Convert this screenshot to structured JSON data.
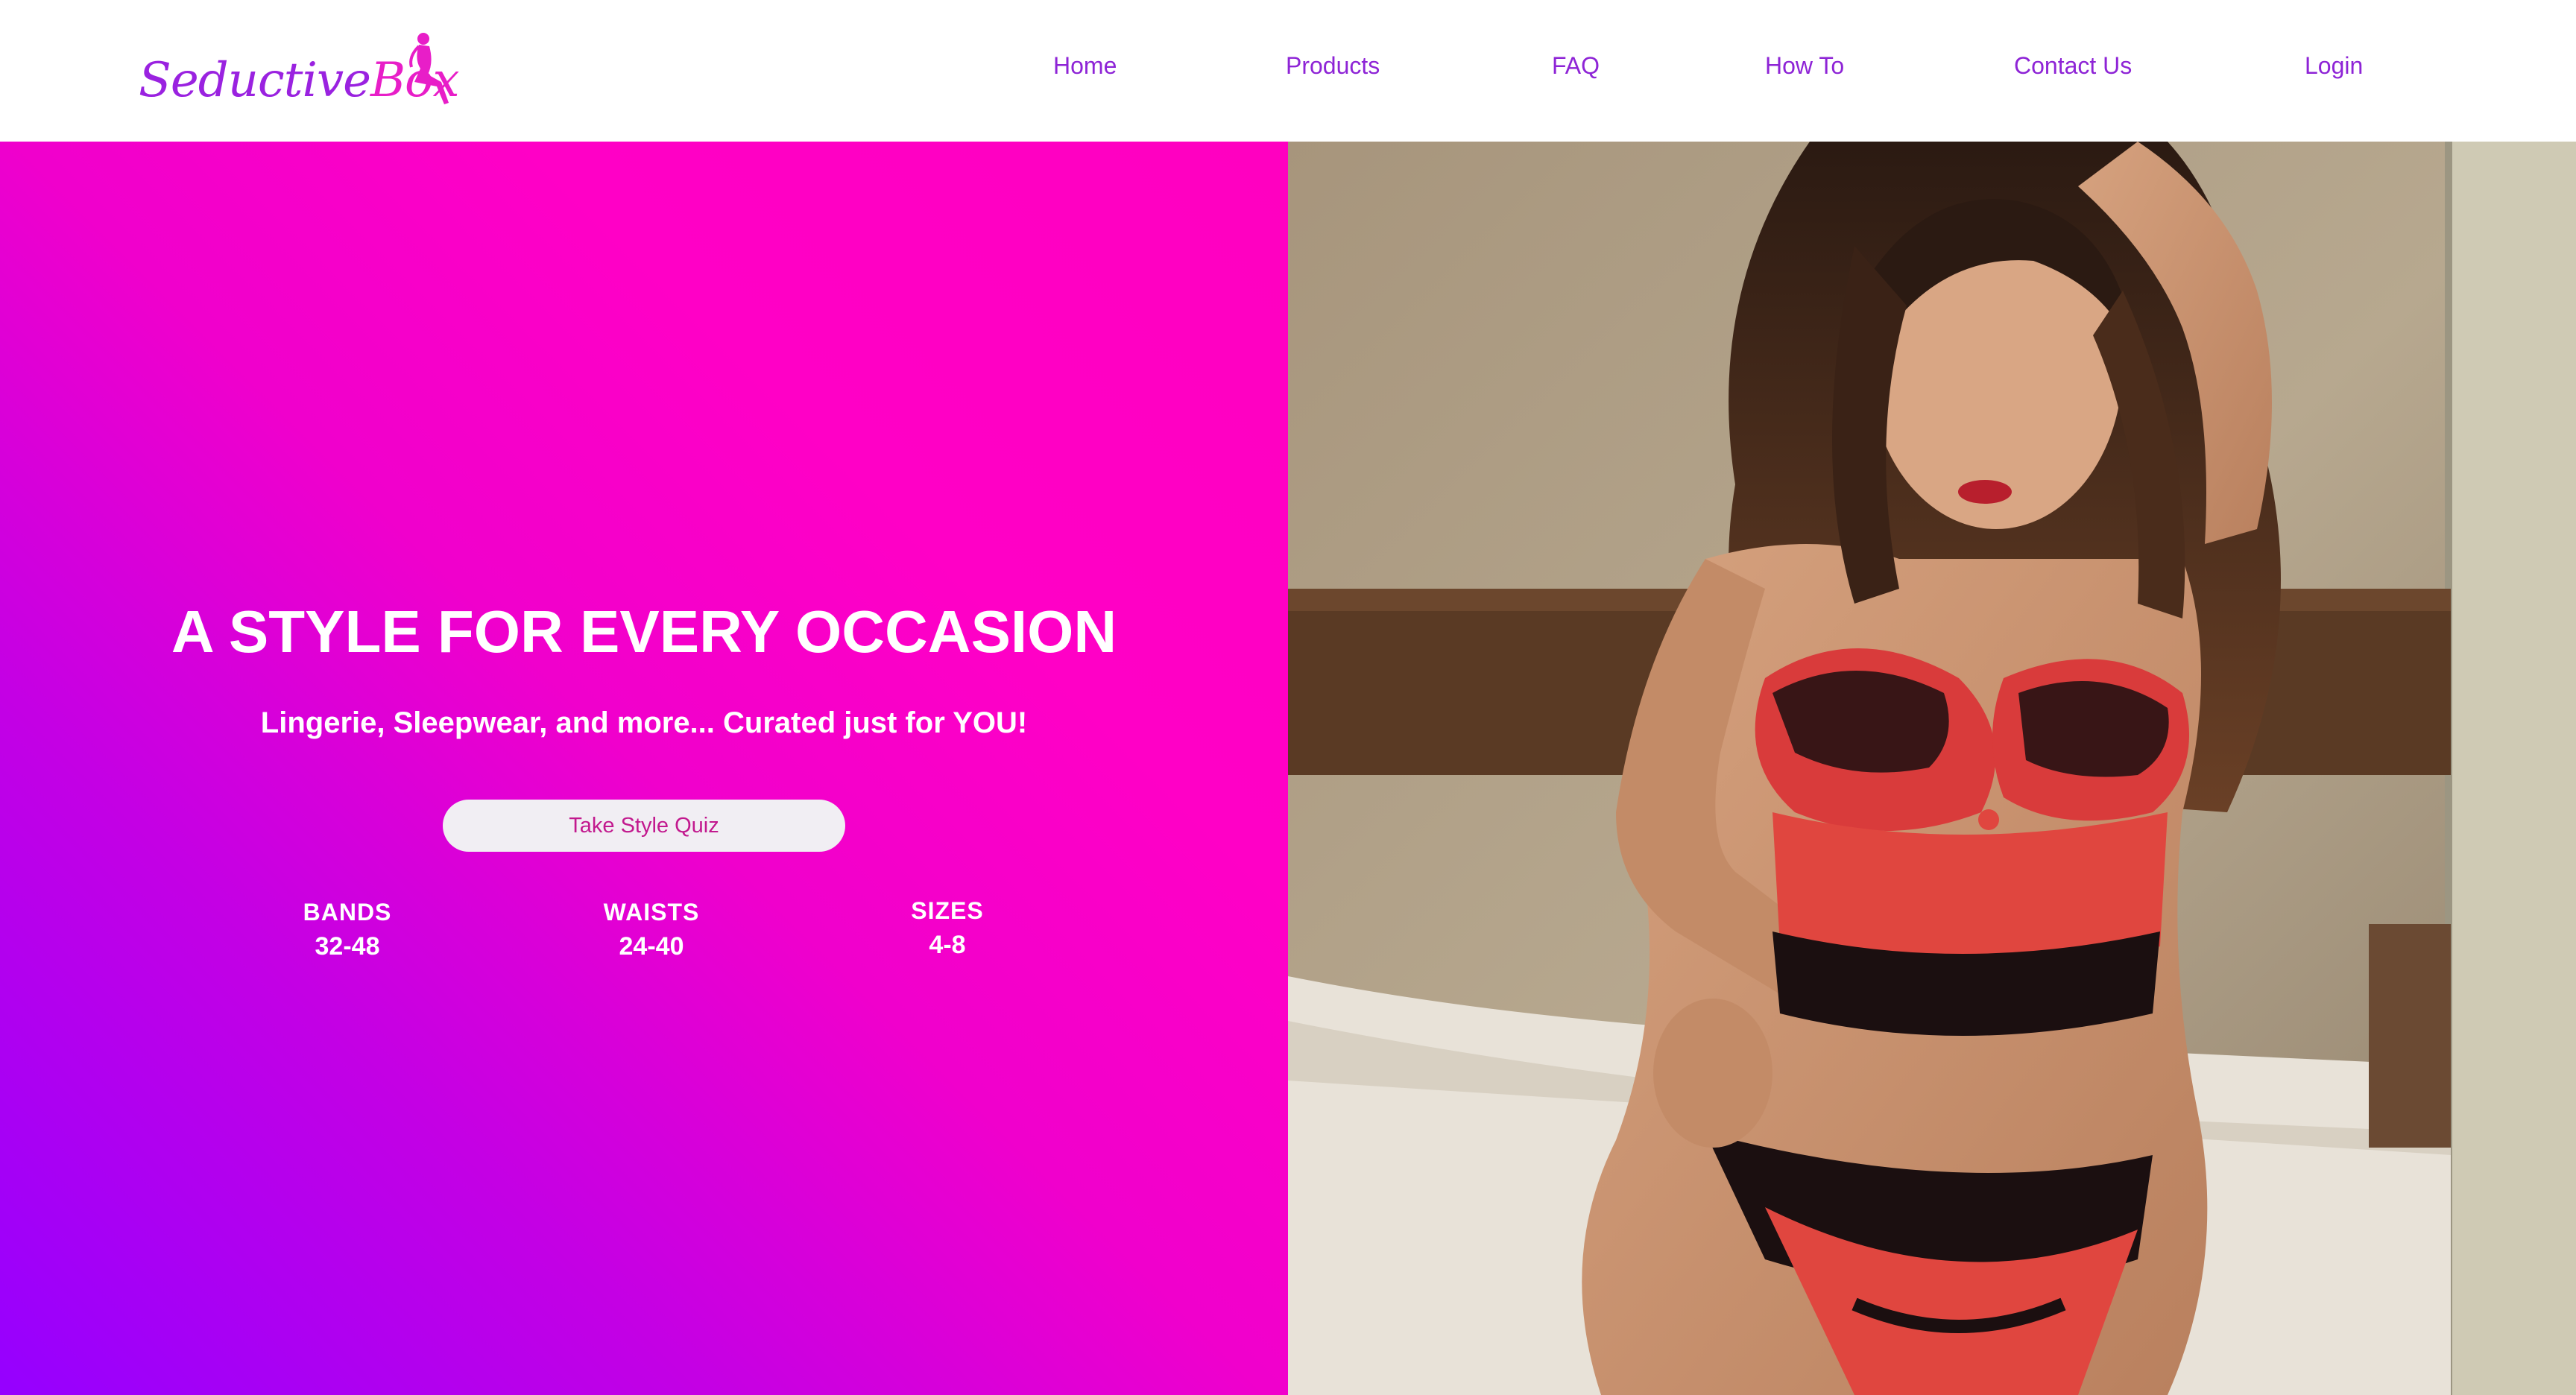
{
  "brand": {
    "logo_text_main": "Seductive",
    "logo_text_accent": "Box",
    "colors": {
      "logo_purple": "#9a22e0",
      "logo_pink": "#e81ec8",
      "nav": "#8e24d6"
    }
  },
  "nav": {
    "items": [
      {
        "label": "Home"
      },
      {
        "label": "Products"
      },
      {
        "label": "FAQ"
      },
      {
        "label": "How To"
      },
      {
        "label": "Contact Us"
      },
      {
        "label": "Login"
      }
    ]
  },
  "hero": {
    "title": "A STYLE FOR EVERY OCCASION",
    "subtitle": "Lingerie, Sleepwear, and more... Curated just for YOU!",
    "cta_label": "Take Style Quiz",
    "gradient": {
      "from": "#9500ff",
      "to": "#ff00c0"
    },
    "stats": [
      {
        "label": "BANDS",
        "value": "32-48"
      },
      {
        "label": "WAISTS",
        "value": "24-40"
      },
      {
        "label": "SIZES",
        "value": "4-8"
      }
    ],
    "photo_icon": "lingerie-model-photo"
  }
}
